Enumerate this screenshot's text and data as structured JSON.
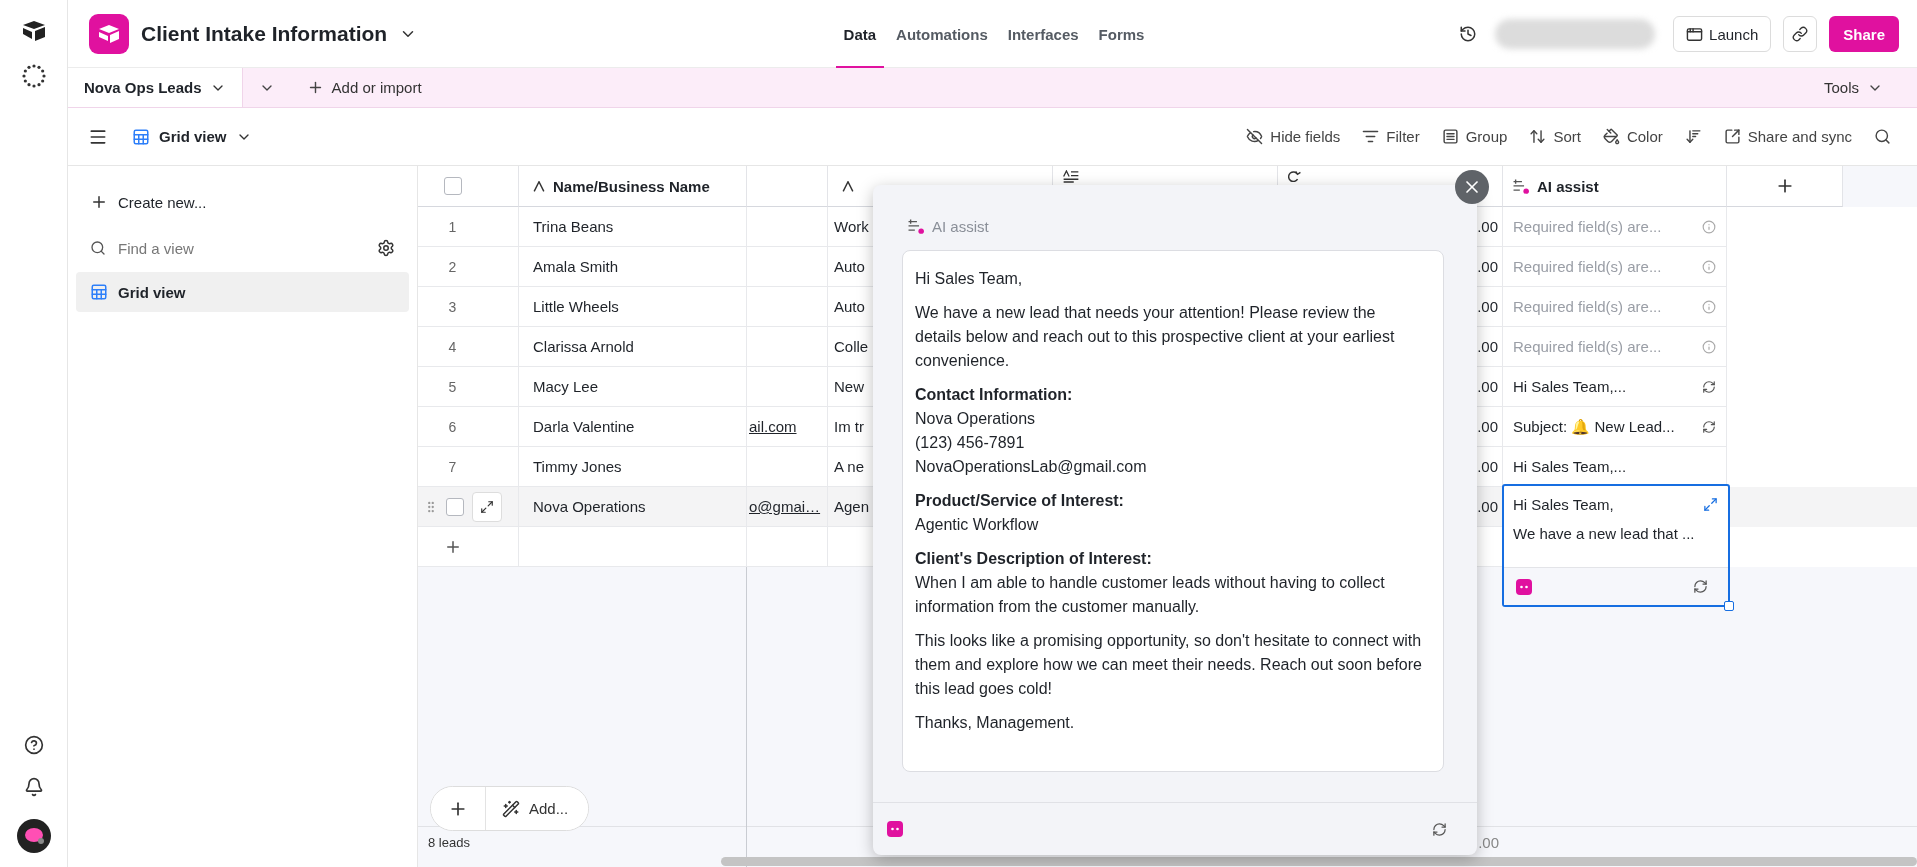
{
  "base": {
    "title": "Client Intake Information"
  },
  "nav_tabs": [
    {
      "label": "Data",
      "selected": true
    },
    {
      "label": "Automations",
      "selected": false
    },
    {
      "label": "Interfaces",
      "selected": false
    },
    {
      "label": "Forms",
      "selected": false
    }
  ],
  "header_buttons": {
    "launch": "Launch",
    "share": "Share"
  },
  "table_tabs": [
    {
      "label": "Nova Ops Leads",
      "selected": true
    }
  ],
  "add_or_import": "Add or import",
  "tools": "Tools",
  "view_switcher": "Grid view",
  "toolbar": [
    {
      "kind": "hide",
      "label": "Hide fields"
    },
    {
      "kind": "filter",
      "label": "Filter"
    },
    {
      "kind": "group",
      "label": "Group"
    },
    {
      "kind": "sort",
      "label": "Sort"
    },
    {
      "kind": "color",
      "label": "Color"
    },
    {
      "kind": "row_height"
    },
    {
      "kind": "share",
      "label": "Share and sync"
    },
    {
      "kind": "search"
    }
  ],
  "sidebar": {
    "create": "Create new...",
    "search_placeholder": "Find a view",
    "views": [
      {
        "label": "Grid view",
        "selected": true
      }
    ]
  },
  "table": {
    "select_all_checked": false,
    "columns": [
      {
        "kind": "text",
        "label": "Name/Business Name"
      },
      {
        "kind": "blank"
      },
      {
        "kind": "text"
      },
      {
        "kind": "long_text"
      },
      {
        "kind": "formula"
      },
      {
        "kind": "ai",
        "label": "AI assist"
      }
    ],
    "rows": [
      {
        "number": "1",
        "name": "Trina Beans",
        "column_4": "Work",
        "column_6": ".00",
        "kind": "error",
        "ai_assist": "Required field(s) are...",
        "hovered": false,
        "checked": false,
        "selected": false
      },
      {
        "number": "2",
        "name": "Amala Smith",
        "column_4": "Auto",
        "column_6": ".00",
        "kind": "error",
        "ai_assist": "Required field(s) are...",
        "hovered": false,
        "checked": false,
        "selected": false
      },
      {
        "number": "3",
        "name": "Little Wheels",
        "column_4": "Auto",
        "column_6": ".00",
        "kind": "error",
        "ai_assist": "Required field(s) are...",
        "hovered": false,
        "checked": false,
        "selected": false
      },
      {
        "number": "4",
        "name": "Clarissa Arnold",
        "column_4": "Colle",
        "column_6": ".00",
        "kind": "error",
        "ai_assist": "Required field(s) are...",
        "hovered": false,
        "checked": false,
        "selected": false
      },
      {
        "number": "5",
        "name": "Macy Lee",
        "column_4": "New",
        "column_6": ".00",
        "kind": "regen",
        "ai_assist": "Hi Sales Team,...",
        "hovered": false,
        "checked": false,
        "selected": false
      },
      {
        "number": "6",
        "name": "Darla Valentine",
        "column_3": "ail.com",
        "column_4": "Im tr",
        "column_6": ".00",
        "kind": "regen",
        "ai_assist": "Subject: 🔔 New Lead...",
        "hovered": false,
        "checked": false,
        "selected": false
      },
      {
        "number": "7",
        "name": "Timmy Jones",
        "column_4": "A ne",
        "column_6": ".00",
        "kind": "plain",
        "ai_assist": "Hi Sales Team,...",
        "hovered": false,
        "checked": false,
        "selected": false
      },
      {
        "name": "Nova Operations",
        "column_3": "o@gmai…",
        "column_4": "Agen",
        "column_6": ".00",
        "kind": "expanded",
        "ai_lines": [
          "Hi Sales Team,",
          "We have a new lead that ..."
        ],
        "hovered": true,
        "checked": false,
        "selected": true
      }
    ],
    "summary": {
      "count": "8 leads",
      "column_6": ".00"
    },
    "add_button": "Add..."
  },
  "ai_popup": {
    "title": "AI assist",
    "paragraphs": [
      {
        "kind": "text",
        "text": "Hi Sales Team,"
      },
      {
        "kind": "text",
        "text": "We have a new lead that needs your attention! Please review the details below and reach out to this prospective client at your earliest convenience."
      },
      {
        "kind": "section",
        "heading": "Contact Information:",
        "lines": [
          "Nova Operations",
          "(123) 456-7891",
          "NovaOperationsLab@gmail.com"
        ]
      },
      {
        "kind": "section",
        "heading": "Product/Service of Interest:",
        "lines": [
          "Agentic Workflow"
        ]
      },
      {
        "kind": "section",
        "heading": "Client's Description of Interest:",
        "lines": [
          "When I am able to handle customer leads without having to collect information from the customer manually."
        ]
      },
      {
        "kind": "text",
        "text": "This looks like a promising opportunity, so don't hesitate to connect with them and explore how we can meet their needs. Reach out soon before this lead goes cold!"
      },
      {
        "kind": "text",
        "text": "Thanks, Management."
      }
    ]
  }
}
